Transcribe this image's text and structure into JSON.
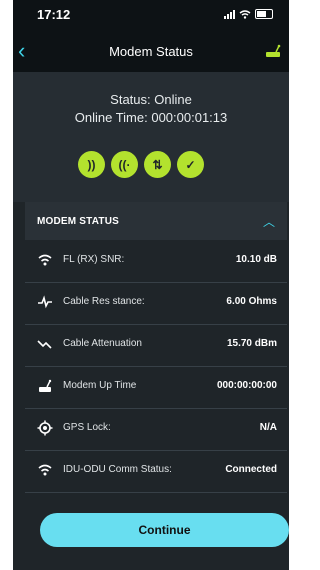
{
  "status_bar": {
    "time": "17:12"
  },
  "header": {
    "title": "Modem Status"
  },
  "summary": {
    "status": "Status: Online",
    "online_time": "Online Time: 000:00:01:13"
  },
  "indicators": [
    {
      "name": "signal-indicator-icon",
      "glyph": "))"
    },
    {
      "name": "radio-indicator-icon",
      "glyph": "((·"
    },
    {
      "name": "transfer-indicator-icon",
      "glyph": "⇅"
    },
    {
      "name": "check-indicator-icon",
      "glyph": "✓"
    }
  ],
  "panel": {
    "header": "MODEM STATUS",
    "rows": [
      {
        "icon": "wifi-icon",
        "label": "FL (RX) SNR:",
        "value": "10.10 dB"
      },
      {
        "icon": "pulse-icon",
        "label": "Cable Res stance:",
        "value": "6.00 Ohms"
      },
      {
        "icon": "attenuation-icon",
        "label": "Cable Attenuation",
        "value": "15.70 dBm"
      },
      {
        "icon": "modem-icon",
        "label": "Modem Up Time",
        "value": "000:00:00:00"
      },
      {
        "icon": "gps-icon",
        "label": "GPS Lock:",
        "value": "N/A"
      },
      {
        "icon": "wifi-icon",
        "label": "IDU-ODU Comm Status:",
        "value": "Connected"
      }
    ]
  },
  "continue_label": "Continue",
  "colors": {
    "accent": "#3fd3e6",
    "indicator": "#b3e22e",
    "button": "#68def0"
  }
}
